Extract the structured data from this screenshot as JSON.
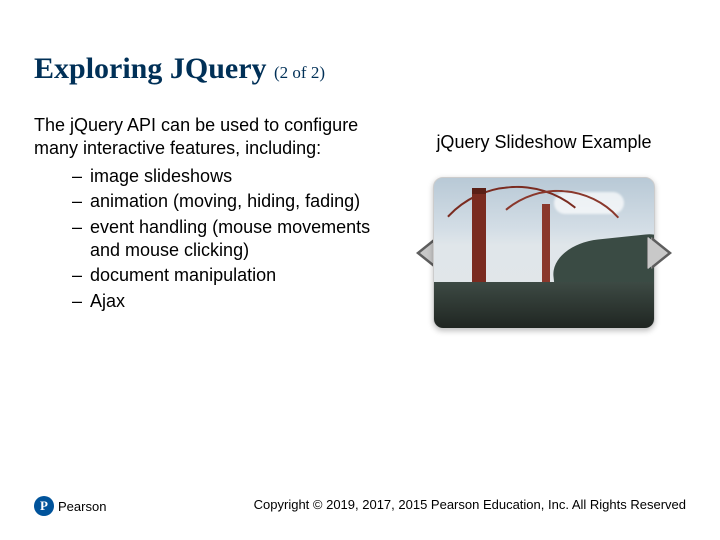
{
  "title": "Exploring JQuery",
  "pager": "(2 of 2)",
  "intro": "The jQuery API can be used to configure many interactive features, including:",
  "bullets": [
    "image slideshows",
    "animation (moving, hiding, fading)",
    "event handling (mouse movements and mouse clicking)",
    "document manipulation",
    "Ajax"
  ],
  "example_title": "jQuery Slideshow Example",
  "copyright": "Copyright © 2019, 2017, 2015 Pearson Education, Inc. All Rights Reserved",
  "publisher": "Pearson",
  "logo_letter": "P"
}
